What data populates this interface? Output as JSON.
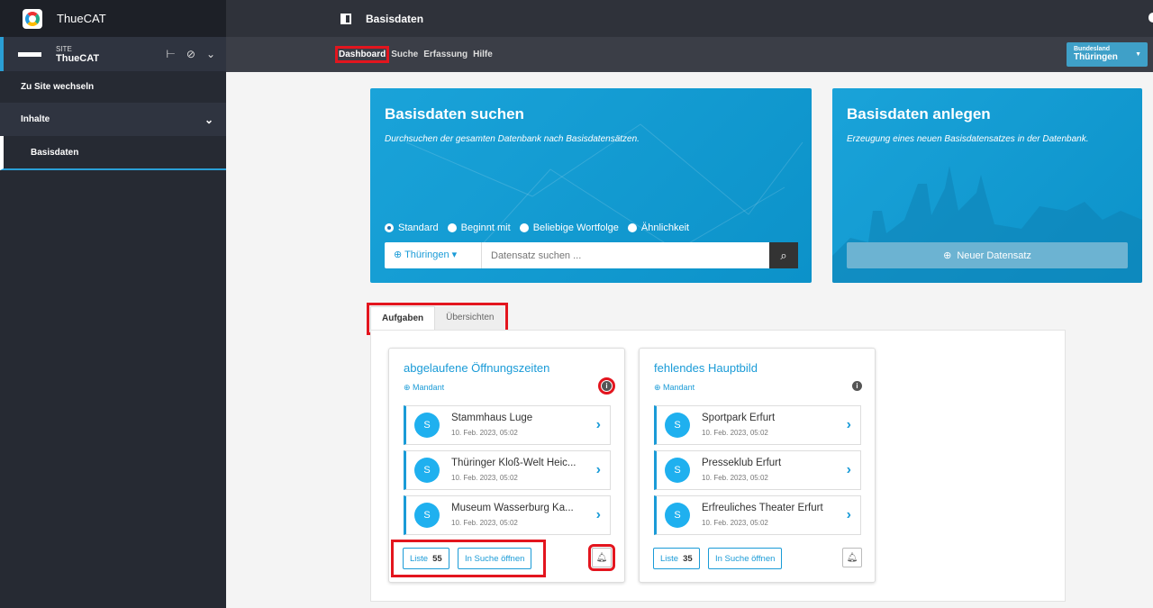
{
  "sidebar": {
    "app_name": "ThueCAT",
    "site_label": "SITE",
    "site_name": "ThueCAT",
    "switch_site": "Zu Site wechseln",
    "group_label": "Inhalte",
    "active_item": "Basisdaten"
  },
  "topbar": {
    "title": "Basisdaten"
  },
  "nav": {
    "tabs": [
      "Dashboard",
      "Suche",
      "Erfassung",
      "Hilfe"
    ],
    "state_label": "Bundesland",
    "state_value": "Thüringen"
  },
  "search_card": {
    "title": "Basisdaten suchen",
    "subtitle": "Durchsuchen der gesamten Datenbank nach Basisdatensätzen.",
    "radios": [
      "Standard",
      "Beginnt mit",
      "Beliebige Wortfolge",
      "Ähnlichkeit"
    ],
    "selected_radio": "Standard",
    "location": "Thüringen",
    "placeholder": "Datensatz suchen ..."
  },
  "create_card": {
    "title": "Basisdaten anlegen",
    "subtitle": "Erzeugung eines neuen Basisdatensatzes in der Datenbank.",
    "button": "Neuer Datensatz"
  },
  "tabs": [
    "Aufgaben",
    "Übersichten"
  ],
  "tasks": [
    {
      "title": "abgelaufene Öffnungszeiten",
      "scope": "Mandant",
      "items": [
        {
          "avatar": "S",
          "name": "Stammhaus Luge",
          "date": "10. Feb. 2023, 05:02"
        },
        {
          "avatar": "S",
          "name": "Thüringer Kloß-Welt Heic...",
          "date": "10. Feb. 2023, 05:02"
        },
        {
          "avatar": "S",
          "name": "Museum Wasserburg Ka...",
          "date": "10. Feb. 2023, 05:02"
        }
      ],
      "list_label": "Liste",
      "list_count": "55",
      "open_label": "In Suche öffnen"
    },
    {
      "title": "fehlendes Hauptbild",
      "scope": "Mandant",
      "items": [
        {
          "avatar": "S",
          "name": "Sportpark Erfurt",
          "date": "10. Feb. 2023, 05:02"
        },
        {
          "avatar": "S",
          "name": "Presseklub Erfurt",
          "date": "10. Feb. 2023, 05:02"
        },
        {
          "avatar": "S",
          "name": "Erfreuliches Theater Erfurt",
          "date": "10. Feb. 2023, 05:02"
        }
      ],
      "list_label": "Liste",
      "list_count": "35",
      "open_label": "In Suche öffnen"
    }
  ],
  "colors": {
    "accent": "#1a9bd7",
    "highlight": "#e3151e",
    "sidebar": "#262a33"
  }
}
